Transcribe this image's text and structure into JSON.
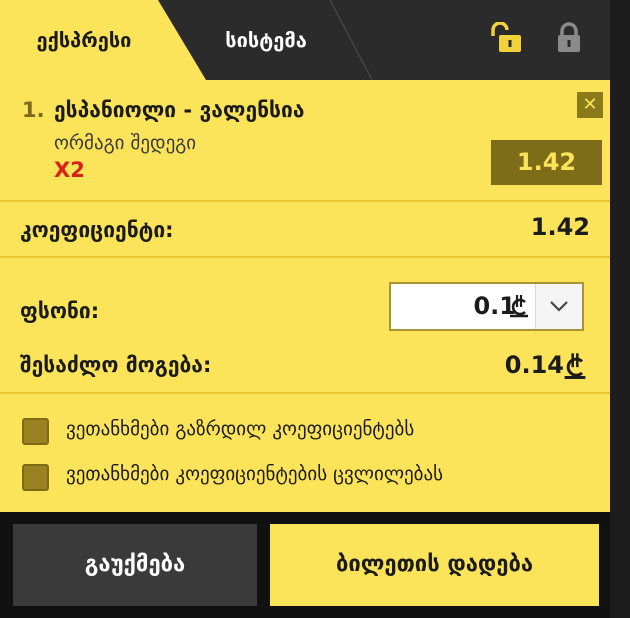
{
  "tabs": {
    "express": "ექსპრესი",
    "system": "სისტემა"
  },
  "icons": {
    "unlocked": "unlocked-lock-icon",
    "locked": "locked-lock-icon"
  },
  "event": {
    "number": "1.",
    "title": "ესპანიოლი - ვალენსია",
    "market": "ორმაგი შედეგი",
    "pick": "X2",
    "odd": "1.42"
  },
  "summary": {
    "coef_label": "კოეფიციენტი:",
    "coef_value": "1.42",
    "stake_label": "ფსონი:",
    "stake_value": "0.1",
    "win_label": "შესაძლო მოგება:",
    "win_value": "0.14"
  },
  "options": [
    {
      "label": "ვეთანხმები გაზრდილ კოეფიციენტებს",
      "checked": false
    },
    {
      "label": "ვეთანხმები კოეფიციენტების ცვლილებას",
      "checked": false
    }
  ],
  "buttons": {
    "cancel": "გაუქმება",
    "place": "ბილეთის დადება"
  },
  "colors": {
    "accent": "#fbe35a",
    "dark": "#2b2b2b",
    "pick": "#d8211a"
  }
}
